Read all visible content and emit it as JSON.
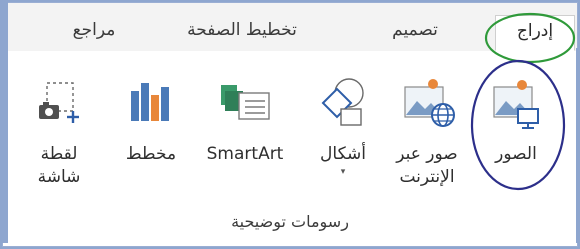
{
  "tabs": [
    {
      "id": "review",
      "label": "مراجع"
    },
    {
      "id": "layout",
      "label": "تخطيط الصفحة"
    },
    {
      "id": "design",
      "label": "تصميم"
    },
    {
      "id": "insert",
      "label": "إدراج",
      "active": true
    }
  ],
  "group": {
    "label": "رسومات توضيحية",
    "buttons": [
      {
        "id": "pictures",
        "line1": "الصور",
        "line2": "",
        "icon": "pictures-icon"
      },
      {
        "id": "online_pictures",
        "line1": "صور عبر",
        "line2": "الإنترنت",
        "icon": "online-pictures-icon"
      },
      {
        "id": "shapes",
        "line1": "أشكال",
        "line2": "▾",
        "icon": "shapes-icon"
      },
      {
        "id": "smartart",
        "line1": "SmartArt",
        "line2": "",
        "icon": "smartart-icon"
      },
      {
        "id": "chart",
        "line1": "مخطط",
        "line2": "",
        "icon": "chart-icon"
      },
      {
        "id": "screenshot",
        "line1": "لقطة",
        "line2": "شاشة",
        "icon": "screenshot-icon"
      }
    ]
  },
  "colors": {
    "frame": "#8ea6cf",
    "accent_blue": "#2e5ea8",
    "annotation_green": "#2f9a3a",
    "annotation_navy": "#2c2f8a"
  }
}
